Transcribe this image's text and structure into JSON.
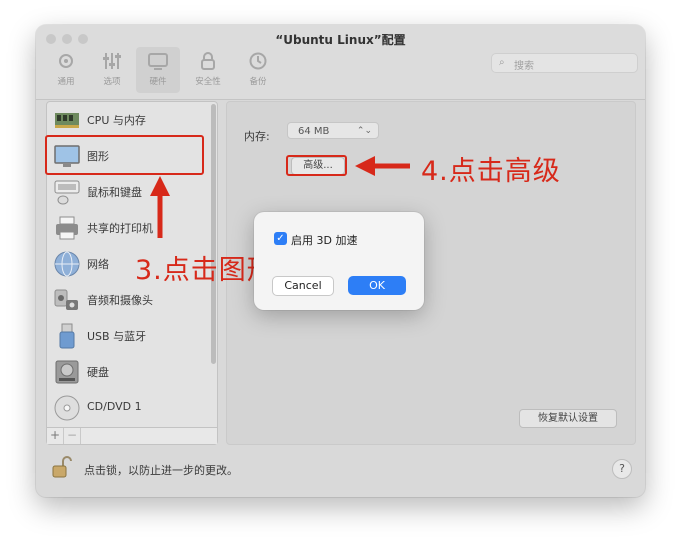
{
  "window": {
    "title": "“Ubuntu Linux”配置"
  },
  "toolbar": {
    "items": [
      {
        "label": "通用"
      },
      {
        "label": "选项"
      },
      {
        "label": "硬件"
      },
      {
        "label": "安全性"
      },
      {
        "label": "备份"
      }
    ],
    "active_index": 2,
    "search_placeholder": "搜索"
  },
  "sidebar": {
    "items": [
      {
        "label": "CPU 与内存",
        "icon": "memory-chip-icon"
      },
      {
        "label": "图形",
        "icon": "monitor-icon"
      },
      {
        "label": "鼠标和键盘",
        "icon": "keyboard-mouse-icon"
      },
      {
        "label": "共享的打印机",
        "icon": "printer-icon"
      },
      {
        "label": "网络",
        "icon": "globe-icon"
      },
      {
        "label": "音频和摄像头",
        "icon": "speaker-camera-icon"
      },
      {
        "label": "USB 与蓝牙",
        "icon": "usb-icon"
      },
      {
        "label": "硬盘",
        "icon": "hard-disk-icon"
      },
      {
        "label": "CD/DVD 1",
        "icon": "cd-dvd-icon"
      }
    ],
    "add_label": "+",
    "remove_label": "−"
  },
  "main": {
    "memory_label": "内存:",
    "memory_value": "64 MB",
    "advanced_button": "高级...",
    "restore_button": "恢复默认设置"
  },
  "dialog": {
    "checkbox_label": "启用 3D 加速",
    "checkbox_checked": true,
    "cancel_label": "Cancel",
    "ok_label": "OK"
  },
  "footer": {
    "lock_text": "点击锁，以防止进一步的更改。",
    "help_label": "?"
  },
  "annotations": {
    "step3": "3.点击图形",
    "step4": "4.点击高级"
  },
  "colors": {
    "annotation": "#d7291a",
    "accent": "#2d7ef6"
  }
}
